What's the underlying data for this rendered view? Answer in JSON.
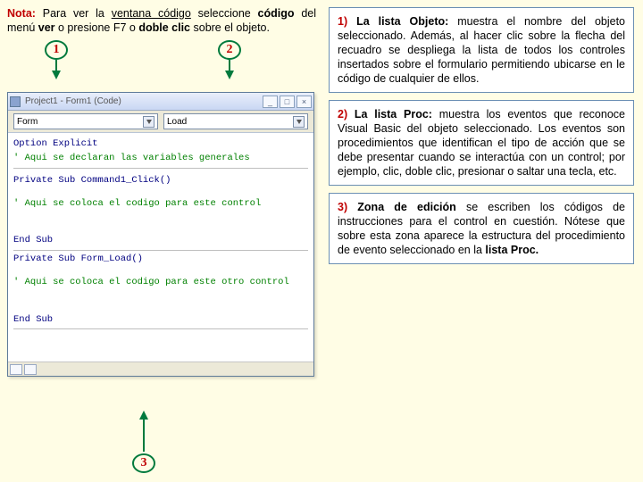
{
  "nota": {
    "label": "Nota:",
    "part1": " Para ver la ",
    "strong1": "ventana código",
    "part2": " seleccione ",
    "strong2": "código",
    "part3": " del menú ",
    "strong3": "ver",
    "part4": " o presione ",
    "strong4": "F7",
    "part5": " o ",
    "strong5": "doble clic",
    "part6": " sobre el objeto."
  },
  "callout": {
    "n1": "1",
    "n2": "2",
    "n3": "3"
  },
  "vb": {
    "title": "Project1 - Form1 (Code)",
    "combo1": "Form",
    "combo2": "Load",
    "code": {
      "l1a": "Option Explicit",
      "l1b": "' Aqui se declaran las variables generales",
      "l2a": "Private Sub Command1_Click()",
      "l2b": "' Aqui se coloca el codigo para este control",
      "l2c": "End Sub",
      "l3a": "Private Sub Form_Load()",
      "l3b": "' Aqui se coloca el codigo para este otro control",
      "l3c": "End Sub"
    },
    "btn_min": "_",
    "btn_max": "□",
    "btn_close": "×"
  },
  "box1": {
    "hd": "1)",
    "strong": " La lista Objeto:",
    "rest": " muestra el nombre del objeto seleccionado. Además, al hacer clic sobre la flecha del recuadro se despliega la lista de todos los controles insertados sobre el formulario permitiendo ubicarse en le código de cualquier  de ellos."
  },
  "box2": {
    "hd": "2)",
    "strong": " La lista Proc:",
    "rest": " muestra los eventos que reconoce Visual Basic del objeto seleccionado. Los eventos son procedimientos que identifican el tipo de acción que se debe presentar cuando se interactúa con un control; por ejemplo, clic, doble clic, presionar o saltar una tecla, etc."
  },
  "box3": {
    "hd": "3)",
    "strong": " Zona de edición",
    "rest1": " se escriben los códigos de instrucciones para el control en cuestión. Nótese que sobre esta zona aparece la estructura del procedimiento de evento seleccionado en la ",
    "proc": "lista Proc."
  }
}
